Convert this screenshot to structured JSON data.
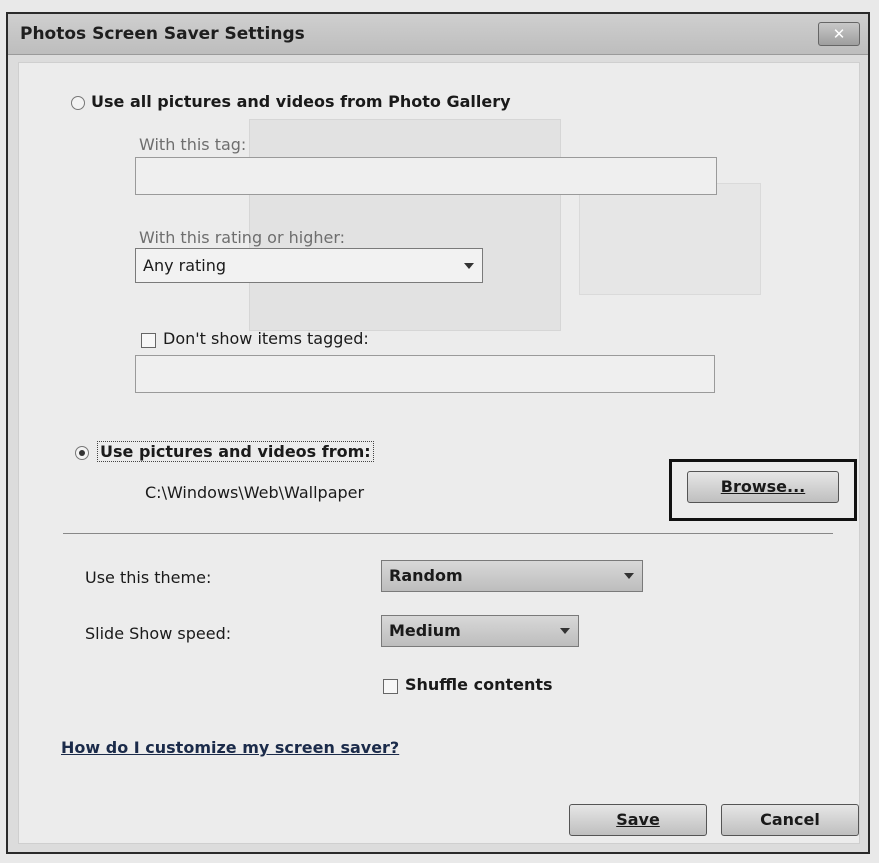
{
  "window": {
    "title": "Photos Screen Saver Settings",
    "close_symbol": "✕"
  },
  "source_gallery": {
    "radio_label": "Use all pictures and videos from Photo Gallery",
    "selected": false,
    "tag_label": "With this tag:",
    "tag_value": "",
    "rating_label": "With this rating or higher:",
    "rating_value": "Any rating",
    "exclude_label": "Don't show items tagged:",
    "exclude_checked": false,
    "exclude_value": ""
  },
  "source_folder": {
    "radio_label": "Use pictures and videos from:",
    "selected": true,
    "path": "C:\\Windows\\Web\\Wallpaper",
    "browse_label": "Browse..."
  },
  "theme": {
    "label": "Use this theme:",
    "value": "Random"
  },
  "speed": {
    "label": "Slide Show speed:",
    "value": "Medium"
  },
  "shuffle": {
    "label": "Shuffle contents",
    "checked": false
  },
  "help_link": "How do I customize my screen saver?",
  "buttons": {
    "save": "Save",
    "cancel": "Cancel"
  },
  "icons": {
    "close": "close-icon",
    "dropdown": "chevron-down-icon"
  }
}
